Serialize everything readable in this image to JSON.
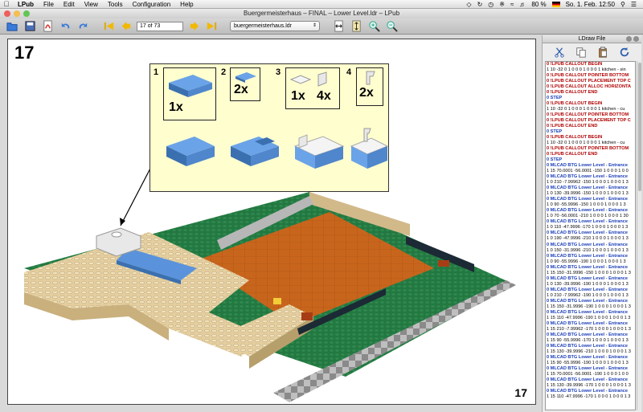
{
  "menubar": {
    "app": "LPub",
    "items": [
      "File",
      "Edit",
      "View",
      "Tools",
      "Configuration",
      "Help"
    ],
    "battery": "80 %",
    "flag_label": "",
    "datetime": "So. 1. Feb.  12:50"
  },
  "window": {
    "title": "Buergermeisterhaus – FINAL – Lower Level.ldr – LPub"
  },
  "toolbar": {
    "page_value": "17 of 73",
    "model_select": "buergermeisterhaus.ldr"
  },
  "page": {
    "step_number": "17",
    "page_number": "17"
  },
  "callout": {
    "steps": [
      {
        "num": "1",
        "quantities": [
          "1x"
        ]
      },
      {
        "num": "2",
        "quantities": [
          "2x"
        ]
      },
      {
        "num": "3",
        "quantities": [
          "1x",
          "4x"
        ]
      },
      {
        "num": "4",
        "quantities": [
          "2x"
        ]
      }
    ]
  },
  "ldraw": {
    "title": "LDraw File",
    "lines": [
      {
        "t": "0 !LPUB CALLOUT BEGIN",
        "k": "meta"
      },
      {
        "t": "1 10 -32 0 1 0 0 0 1 0 0 0 1 kitchen - sin",
        "k": "data"
      },
      {
        "t": "0 !LPUB CALLOUT POINTER BOTTOM",
        "k": "meta"
      },
      {
        "t": "0 !LPUB CALLOUT PLACEMENT TOP C",
        "k": "meta"
      },
      {
        "t": "0 !LPUB CALLOUT ALLOC HORIZONTA",
        "k": "meta"
      },
      {
        "t": "0 !LPUB CALLOUT END",
        "k": "meta"
      },
      {
        "t": "0 STEP",
        "k": "step"
      },
      {
        "t": "0 !LPUB CALLOUT BEGIN",
        "k": "meta"
      },
      {
        "t": "1 10 -32 0 1 0 0 0 1 0 0 0 1 kitchen - cu",
        "k": "data"
      },
      {
        "t": "0 !LPUB CALLOUT POINTER BOTTOM",
        "k": "meta"
      },
      {
        "t": "0 !LPUB CALLOUT PLACEMENT TOP C",
        "k": "meta"
      },
      {
        "t": "0 !LPUB CALLOUT END",
        "k": "meta"
      },
      {
        "t": "0 STEP",
        "k": "step"
      },
      {
        "t": "0 !LPUB CALLOUT BEGIN",
        "k": "meta"
      },
      {
        "t": "1 10 -32 0 1 0 0 0 1 0 0 0 1 kitchen - cu",
        "k": "data"
      },
      {
        "t": "0 !LPUB CALLOUT POINTER BOTTOM",
        "k": "meta"
      },
      {
        "t": "0 !LPUB CALLOUT END",
        "k": "meta"
      },
      {
        "t": "0 STEP",
        "k": "step"
      },
      {
        "t": "0 MLCAD BTG Lower Level - Entrance",
        "k": "mlcad"
      },
      {
        "t": "1 15 70.0001 -56.0001 -150 1 0 0 0 1 0 0",
        "k": "data"
      },
      {
        "t": "0 MLCAD BTG Lower Level - Entrance",
        "k": "mlcad"
      },
      {
        "t": "1 0 210 -7.99962 -150 1 0 0 0 1 0 0 0 1 3",
        "k": "data"
      },
      {
        "t": "0 MLCAD BTG Lower Level - Entrance",
        "k": "mlcad"
      },
      {
        "t": "1 0 130 -39.9996 -150 1 0 0 0 1 0 0 0 1 3",
        "k": "data"
      },
      {
        "t": "0 MLCAD BTG Lower Level - Entrance",
        "k": "mlcad"
      },
      {
        "t": "1 0 90 -55.9996 -150 1 0 0 0 1 0 0 0 1 3",
        "k": "data"
      },
      {
        "t": "0 MLCAD BTG Lower Level - Entrance",
        "k": "mlcad"
      },
      {
        "t": "1 0 70 -56.0001 -210 1 0 0 0 1 0 0 0 1 30",
        "k": "data"
      },
      {
        "t": "0 MLCAD BTG Lower Level - Entrance",
        "k": "mlcad"
      },
      {
        "t": "1 0 110 -47.9996 -170 1 0 0 0 1 0 0 0 1 3",
        "k": "data"
      },
      {
        "t": "0 MLCAD BTG Lower Level - Entrance",
        "k": "mlcad"
      },
      {
        "t": "1 0 190 -47.9996 -210 1 0 0 0 1 0 0 0 1 3",
        "k": "data"
      },
      {
        "t": "0 MLCAD BTG Lower Level - Entrance",
        "k": "mlcad"
      },
      {
        "t": "1 0 150 -31.9996 -210 1 0 0 0 1 0 0 0 1 3",
        "k": "data"
      },
      {
        "t": "0 MLCAD BTG Lower Level - Entrance",
        "k": "mlcad"
      },
      {
        "t": "1 0 90 -55.9996 -190 1 0 0 0 1 0 0 0 1 3",
        "k": "data"
      },
      {
        "t": "0 MLCAD BTG Lower Level - Entrance",
        "k": "mlcad"
      },
      {
        "t": "1 15 150 -31.9996 -150 1 0 0 0 1 0 0 0 1 3",
        "k": "data"
      },
      {
        "t": "0 MLCAD BTG Lower Level - Entrance",
        "k": "mlcad"
      },
      {
        "t": "1 0 130 -39.9996 -190 1 0 0 0 1 0 0 0 1 3",
        "k": "data"
      },
      {
        "t": "0 MLCAD BTG Lower Level - Entrance",
        "k": "mlcad"
      },
      {
        "t": "1 0 210 -7.99962 -190 1 0 0 0 1 0 0 0 1 3",
        "k": "data"
      },
      {
        "t": "0 MLCAD BTG Lower Level - Entrance",
        "k": "mlcad"
      },
      {
        "t": "1 15 150 -31.9996 -190 1 0 0 0 1 0 0 0 1 3",
        "k": "data"
      },
      {
        "t": "0 MLCAD BTG Lower Level - Entrance",
        "k": "mlcad"
      },
      {
        "t": "1 15 110 -47.9996 -190 1 0 0 0 1 0 0 0 1 3",
        "k": "data"
      },
      {
        "t": "0 MLCAD BTG Lower Level - Entrance",
        "k": "mlcad"
      },
      {
        "t": "1 15 210 -7.99962 -170 1 0 0 0 1 0 0 0 1 3",
        "k": "data"
      },
      {
        "t": "0 MLCAD BTG Lower Level - Entrance",
        "k": "mlcad"
      },
      {
        "t": "1 15 90 -55.9996 -170 1 0 0 0 1 0 0 0 1 3",
        "k": "data"
      },
      {
        "t": "0 MLCAD BTG Lower Level - Entrance",
        "k": "mlcad"
      },
      {
        "t": "1 15 130 -39.9996 -210 1 0 0 0 1 0 0 0 1 3",
        "k": "data"
      },
      {
        "t": "0 MLCAD BTG Lower Level - Entrance",
        "k": "mlcad"
      },
      {
        "t": "1 15 90 -55.9996 -190 1 0 0 0 1 0 0 0 1 3",
        "k": "data"
      },
      {
        "t": "0 MLCAD BTG Lower Level - Entrance",
        "k": "mlcad"
      },
      {
        "t": "1 15 70.0001 -56.0001 -190 1 0 0 0 1 0 0",
        "k": "data"
      },
      {
        "t": "0 MLCAD BTG Lower Level - Entrance",
        "k": "mlcad"
      },
      {
        "t": "1 15 130 -39.9996 -170 1 0 0 0 1 0 0 0 1 3",
        "k": "data"
      },
      {
        "t": "0 MLCAD BTG Lower Level - Entrance",
        "k": "mlcad"
      },
      {
        "t": "1 15 110 -47.9996 -170 1 0 0 0 1 0 0 0 1 3",
        "k": "data"
      }
    ]
  },
  "colors": {
    "callout_bg": "#fffecf",
    "tan": "#e4cd9e",
    "green": "#237841",
    "orange": "#c8651c",
    "blue": "#5a93db",
    "gray": "#9ba19d",
    "black": "#1b2a34"
  }
}
